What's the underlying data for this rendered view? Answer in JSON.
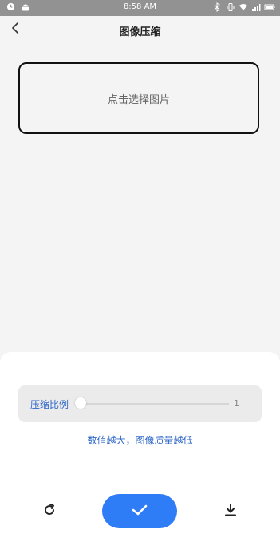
{
  "status_bar": {
    "time": "8:58 AM",
    "left_icons": [
      "alarm-icon",
      "android-icon"
    ],
    "right_icons": [
      "bluetooth-icon",
      "vibrate-icon",
      "wifi-icon",
      "signal-icon",
      "battery-icon"
    ]
  },
  "header": {
    "title": "图像压缩",
    "back_icon": "chevron-left-icon"
  },
  "picker": {
    "label": "点击选择图片"
  },
  "compression": {
    "label": "压缩比例",
    "value": "1",
    "slider_fraction": 0
  },
  "hint": "数值越大，图像质量越低",
  "actions": {
    "refresh_icon": "refresh-icon",
    "confirm_icon": "check-icon",
    "download_icon": "download-icon"
  },
  "colors": {
    "accent": "#2f7df6",
    "accent_text": "#2f67c9",
    "status_bar": "#929292"
  }
}
